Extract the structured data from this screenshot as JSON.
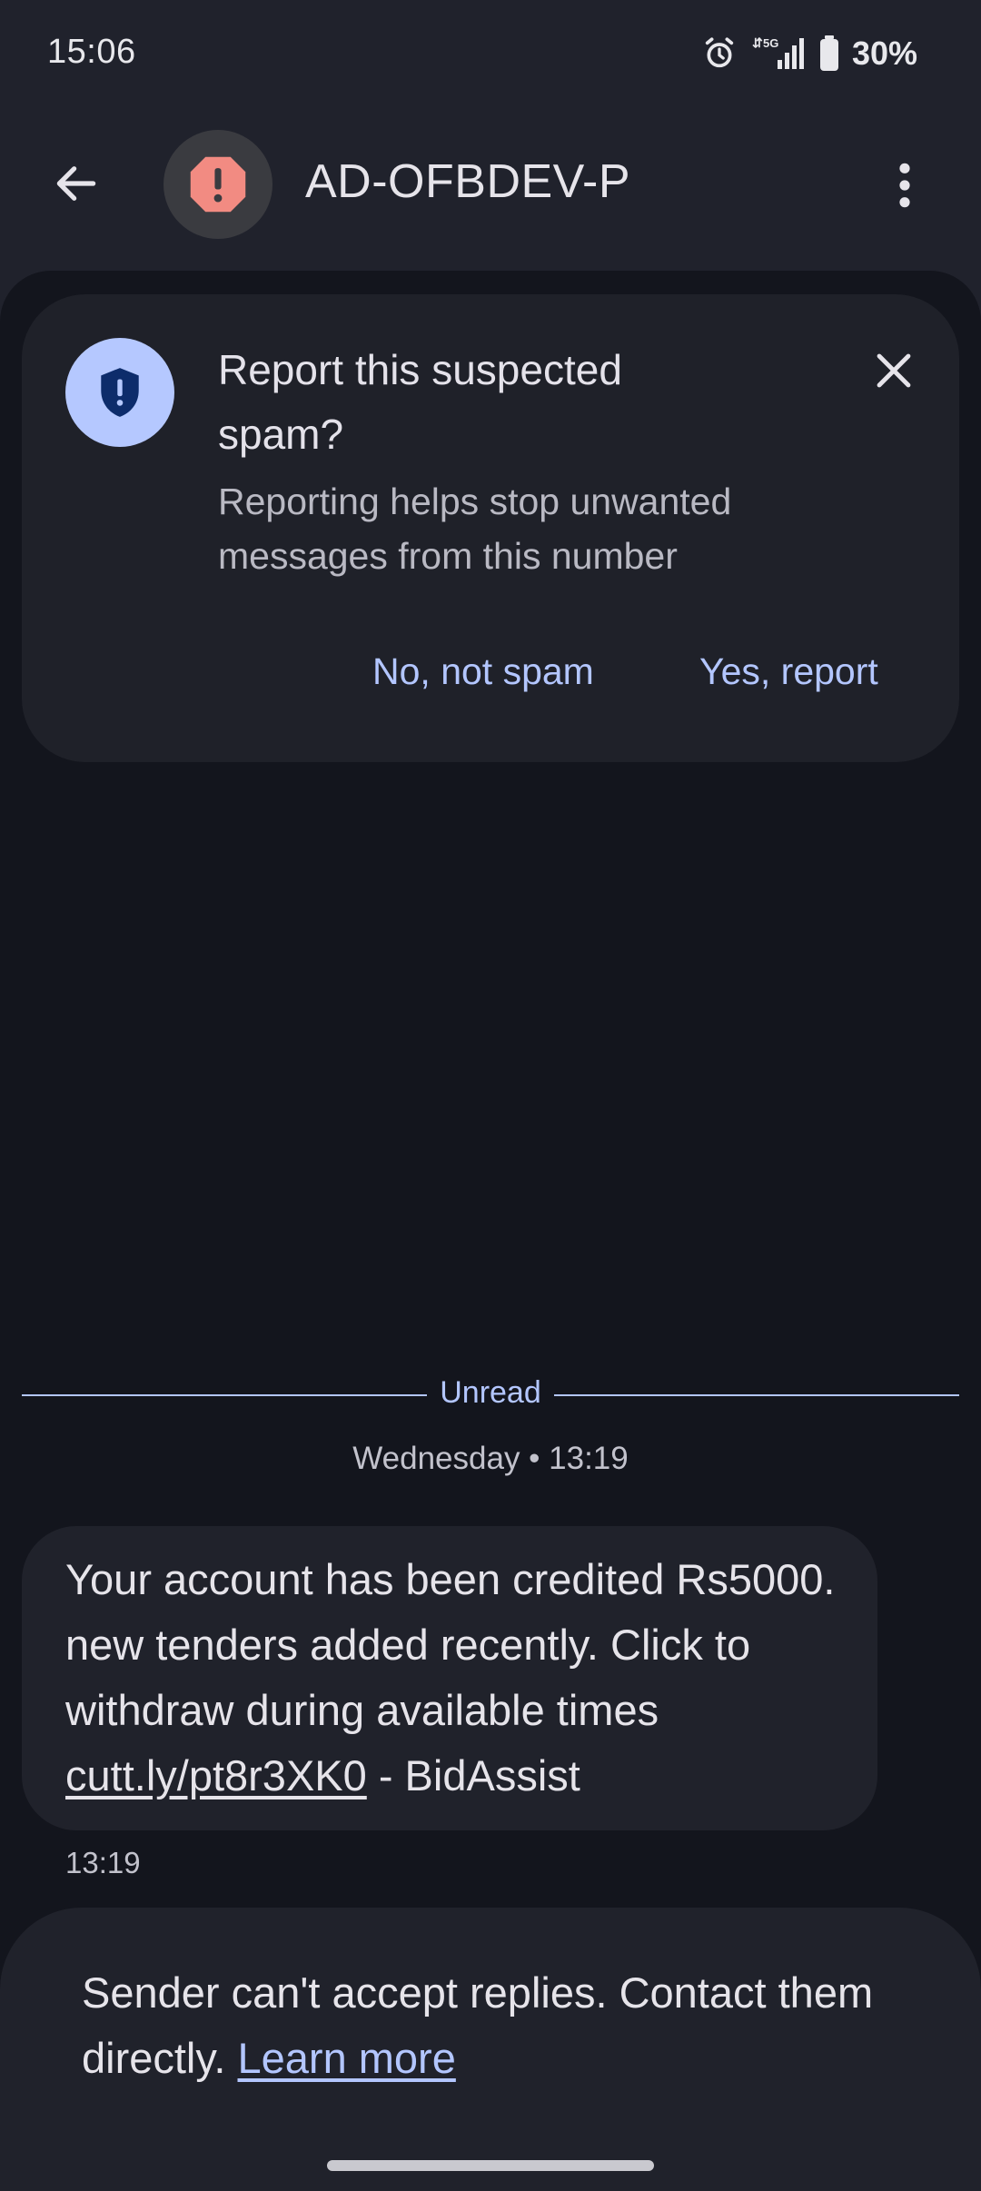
{
  "status_bar": {
    "time": "15:06",
    "network": "5G",
    "battery": "30%"
  },
  "header": {
    "title": "AD-OFBDEV-P",
    "avatar_icon": "warning-icon",
    "accent_color": "#f28b82"
  },
  "spam_card": {
    "title": "Report this suspected spam?",
    "description": "Reporting helps stop unwanted messages from this number",
    "no_button": "No, not spam",
    "yes_button": "Yes, report",
    "icon": "shield-icon"
  },
  "thread": {
    "unread_label": "Unread",
    "date_label": "Wednesday • 13:19",
    "message": {
      "text_before_link": "Your account has been credited Rs5000. new tenders added recently. Click to withdraw during available times ",
      "link": "cutt.ly/pt8r3XK0",
      "text_after_link": " - BidAssist",
      "time": "13:19"
    }
  },
  "footer": {
    "notice": "Sender can't accept replies. Contact them directly. ",
    "learn_more": "Learn more"
  },
  "colors": {
    "background": "#13151d",
    "surface": "#20222b",
    "accent": "#b3c6ff"
  }
}
